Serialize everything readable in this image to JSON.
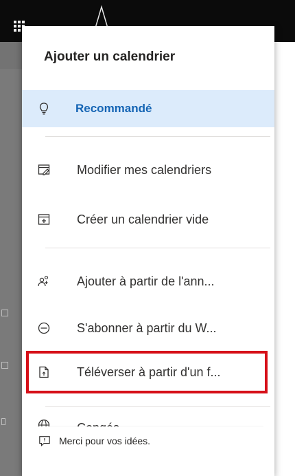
{
  "dialog": {
    "title": "Ajouter un calendrier"
  },
  "menu": {
    "recommended": {
      "label": "Recommandé",
      "icon": "lightbulb-icon"
    },
    "edit_calendars": {
      "label": "Modifier mes calendriers",
      "icon": "edit-calendar-icon"
    },
    "create_blank": {
      "label": "Créer un calendrier vide",
      "icon": "add-calendar-icon"
    },
    "from_directory": {
      "label": "Ajouter à partir de l'ann...",
      "icon": "people-icon"
    },
    "subscribe_web": {
      "label": "S'abonner à partir du W...",
      "icon": "link-circle-icon"
    },
    "upload_file": {
      "label": "Téléverser à partir d'un f...",
      "icon": "file-upload-icon"
    },
    "holidays": {
      "label": "Congés",
      "icon": "globe-icon"
    }
  },
  "feedback": {
    "label": "Merci pour vos idées.",
    "icon": "feedback-icon"
  },
  "colors": {
    "accent": "#1464b4",
    "highlight_border": "#d60f18",
    "recommended_bg": "#dcebfb",
    "topbar": "#0b0b0b"
  }
}
